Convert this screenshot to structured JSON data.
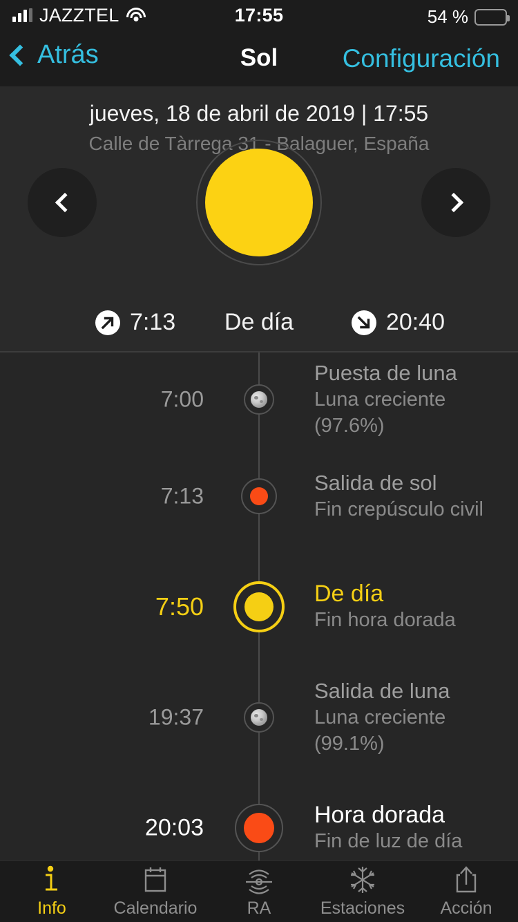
{
  "status_bar": {
    "carrier": "JAZZTEL",
    "time": "17:55",
    "battery_percent": "54 %",
    "battery_level": 54,
    "wifi_icon": "wifi-icon",
    "signal_icon": "cellular-signal-icon"
  },
  "nav_bar": {
    "back_label": "Atrás",
    "title": "Sol",
    "settings_label": "Configuración"
  },
  "header": {
    "date": "jueves, 18 de abril de 2019 | 17:55",
    "location": "Calle de Tàrrega 31 - Balaguer, España",
    "prev_label": "‹",
    "next_label": "›",
    "sun_icon": "sun-icon",
    "sunrise_time": "7:13",
    "sunrise_icon": "sunrise-arrow-icon",
    "phase_label": "De día",
    "sunset_time": "20:40",
    "sunset_icon": "sunset-arrow-icon"
  },
  "timeline": {
    "events": [
      {
        "time": "7:00",
        "title": "Puesta de luna",
        "subtitle": "Luna creciente (97.6%)",
        "marker": "moon",
        "style": "normal"
      },
      {
        "time": "7:13",
        "title": "Salida de sol",
        "subtitle": "Fin crepúsculo civil",
        "marker": "sun-orange-small",
        "style": "normal"
      },
      {
        "time": "7:50",
        "title": "De día",
        "subtitle": "Fin hora dorada",
        "marker": "sun-yellow-large",
        "style": "highlight"
      },
      {
        "time": "19:37",
        "title": "Salida de luna",
        "subtitle": "Luna creciente (99.1%)",
        "marker": "moon",
        "style": "normal"
      },
      {
        "time": "20:03",
        "title": "Hora dorada",
        "subtitle": "Fin de luz de día",
        "marker": "sun-orange-large",
        "style": "current"
      }
    ]
  },
  "tab_bar": {
    "tabs": [
      {
        "label": "Info",
        "icon": "info-icon",
        "active": true
      },
      {
        "label": "Calendario",
        "icon": "calendar-icon",
        "active": false
      },
      {
        "label": "RA",
        "icon": "augmented-reality-icon",
        "active": false
      },
      {
        "label": "Estaciones",
        "icon": "snowflake-icon",
        "active": false
      },
      {
        "label": "Acción",
        "icon": "share-icon",
        "active": false
      }
    ]
  },
  "colors": {
    "accent_cyan": "#35bfe0",
    "accent_yellow": "#f5cf14",
    "sun_yellow": "#fcd213",
    "orange": "#fa4b16",
    "background": "#2a2a2a",
    "bar_background": "#1c1c1c"
  }
}
